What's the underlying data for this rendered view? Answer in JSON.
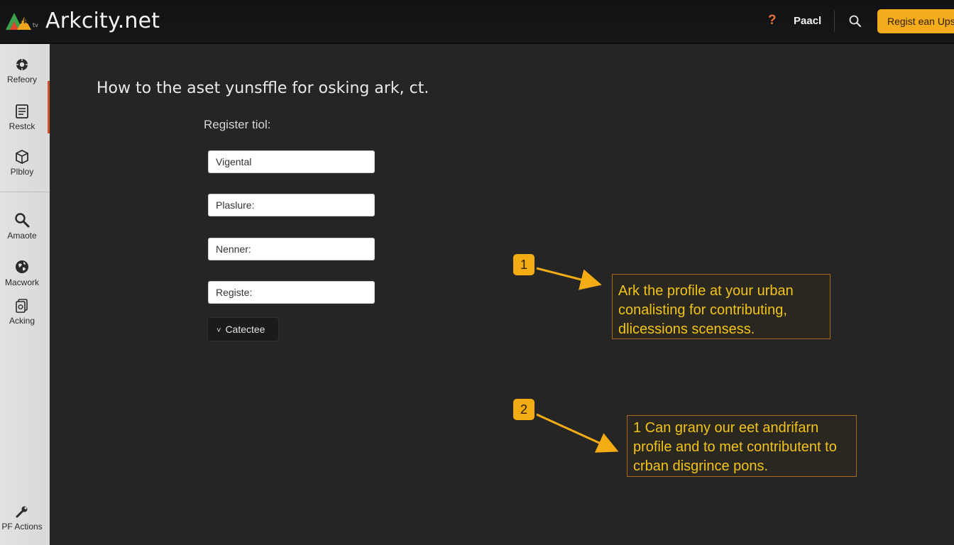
{
  "header": {
    "title": "Arkcity.net",
    "logo_icon": "ark-logo-icon",
    "help_icon": "question-icon",
    "help_glyph": "?",
    "profile_label": "Paacl",
    "search_icon": "search-icon",
    "register_label": "Regist ean Ups"
  },
  "sidebar": {
    "items": [
      {
        "label": "Refeory",
        "icon": "gear-icon"
      },
      {
        "label": "Restck",
        "icon": "list-icon"
      },
      {
        "label": "Plbloy",
        "icon": "box-icon"
      },
      {
        "label": "Amaote",
        "icon": "search-icon"
      },
      {
        "label": "Macwork",
        "icon": "globe-icon"
      },
      {
        "label": "Acking",
        "icon": "document-icon"
      },
      {
        "label": "PF Actions",
        "icon": "wrench-icon"
      }
    ]
  },
  "main": {
    "heading": "How to the aset yunsffle for osking ark, ct.",
    "form_label": "Register tiol:",
    "fields": [
      {
        "placeholder": "Vigental"
      },
      {
        "placeholder": "Plaslure:"
      },
      {
        "placeholder": "Nenner:"
      },
      {
        "placeholder": "Registe:"
      }
    ],
    "select_label": "Catectee",
    "select_chevron": "˅"
  },
  "callouts": [
    {
      "number": "1",
      "text": "Ark the profile at your urban conalisting for contributing, dlicessions scensess."
    },
    {
      "number": "2",
      "text": "1 Can grany our eet andrifarn profile and to met contributent to crban disgrince pons."
    }
  ],
  "colors": {
    "accent": "#f5ac1c",
    "callout_text": "#f2c419",
    "sidebar_accent": "#d0502a",
    "background": "#252525"
  }
}
